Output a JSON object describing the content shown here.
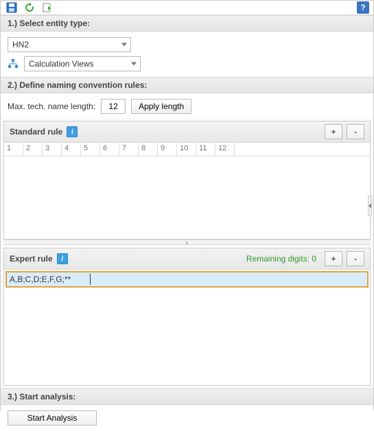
{
  "toolbar": {
    "save_icon": "save-icon",
    "refresh_icon": "refresh-icon",
    "export_icon": "export-icon",
    "help_label": "?"
  },
  "section1": {
    "title": "1.) Select entity type:",
    "entity_value": "HN2",
    "view_value": "Calculation Views"
  },
  "section2": {
    "title": "2.) Define naming convention rules:",
    "max_label": "Max. tech. name length:",
    "max_value": "12",
    "apply_label": "Apply length"
  },
  "standard": {
    "title": "Standard rule",
    "info": "i",
    "add": "+",
    "remove": "-",
    "ruler": [
      "1",
      "2",
      "3",
      "4",
      "5",
      "6",
      "7",
      "8",
      "9",
      "10",
      "11",
      "12"
    ]
  },
  "expert": {
    "title": "Expert rule",
    "info": "i",
    "remaining_label": "Remaining digits: ",
    "remaining_value": "0",
    "add": "+",
    "remove": "-",
    "rule_value": "A,B;C,D;E,F,G;**"
  },
  "section3": {
    "title": "3.) Start analysis:",
    "start_label": "Start Analysis"
  }
}
